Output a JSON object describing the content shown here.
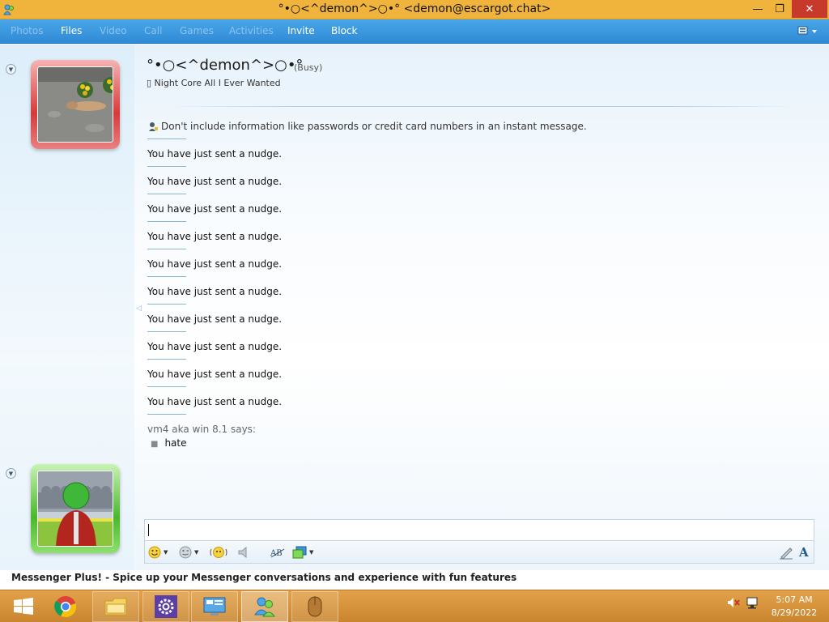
{
  "window": {
    "title": "°•○<^demon^>○•° <demon@escargot.chat>",
    "minimize_glyph": "—",
    "maximize_glyph": "❐",
    "close_glyph": "✕"
  },
  "toolbar": {
    "photos": "Photos",
    "files": "Files",
    "video": "Video",
    "call": "Call",
    "games": "Games",
    "activities": "Activities",
    "invite": "Invite",
    "block": "Block"
  },
  "contact": {
    "name": "°•○<^demon^>○•°",
    "status": "(Busy)",
    "personal_message": "▯ Night Core All I Ever Wanted",
    "status_color": "#d63a3a"
  },
  "conversation": {
    "warning": "Don't include information like passwords or credit card numbers in an instant message.",
    "nudges": [
      "You have just sent a nudge.",
      "You have just sent a nudge.",
      "You have just sent a nudge.",
      "You have just sent a nudge.",
      "You have just sent a nudge.",
      "You have just sent a nudge.",
      "You have just sent a nudge.",
      "You have just sent a nudge.",
      "You have just sent a nudge.",
      "You have just sent a nudge."
    ],
    "sender_line": "vm4 aka win 8.1 says:",
    "message": "hate"
  },
  "input": {
    "value": "",
    "emoticon_icon": "smiley-icon",
    "wink_icon": "wink-icon",
    "nudge_icon": "nudge-icon",
    "voice_icon": "voice-clip-icon",
    "translate_icon": "translate-icon",
    "background_icon": "background-icon",
    "handwriting_icon": "handwriting-icon",
    "font_icon": "font-icon",
    "font_label": "A",
    "translate_label": "AB"
  },
  "plus_banner": "Messenger Plus! - Spice up your Messenger conversations and experience with fun features",
  "taskbar": {
    "time": "5:07 AM",
    "date": "8/29/2022"
  },
  "colors": {
    "titlebar": "#f0b43c",
    "toolbar": "#3a95dd",
    "taskbar": "#d8933a",
    "busy_frame": "#d63a3a",
    "online_frame": "#49b82b"
  }
}
